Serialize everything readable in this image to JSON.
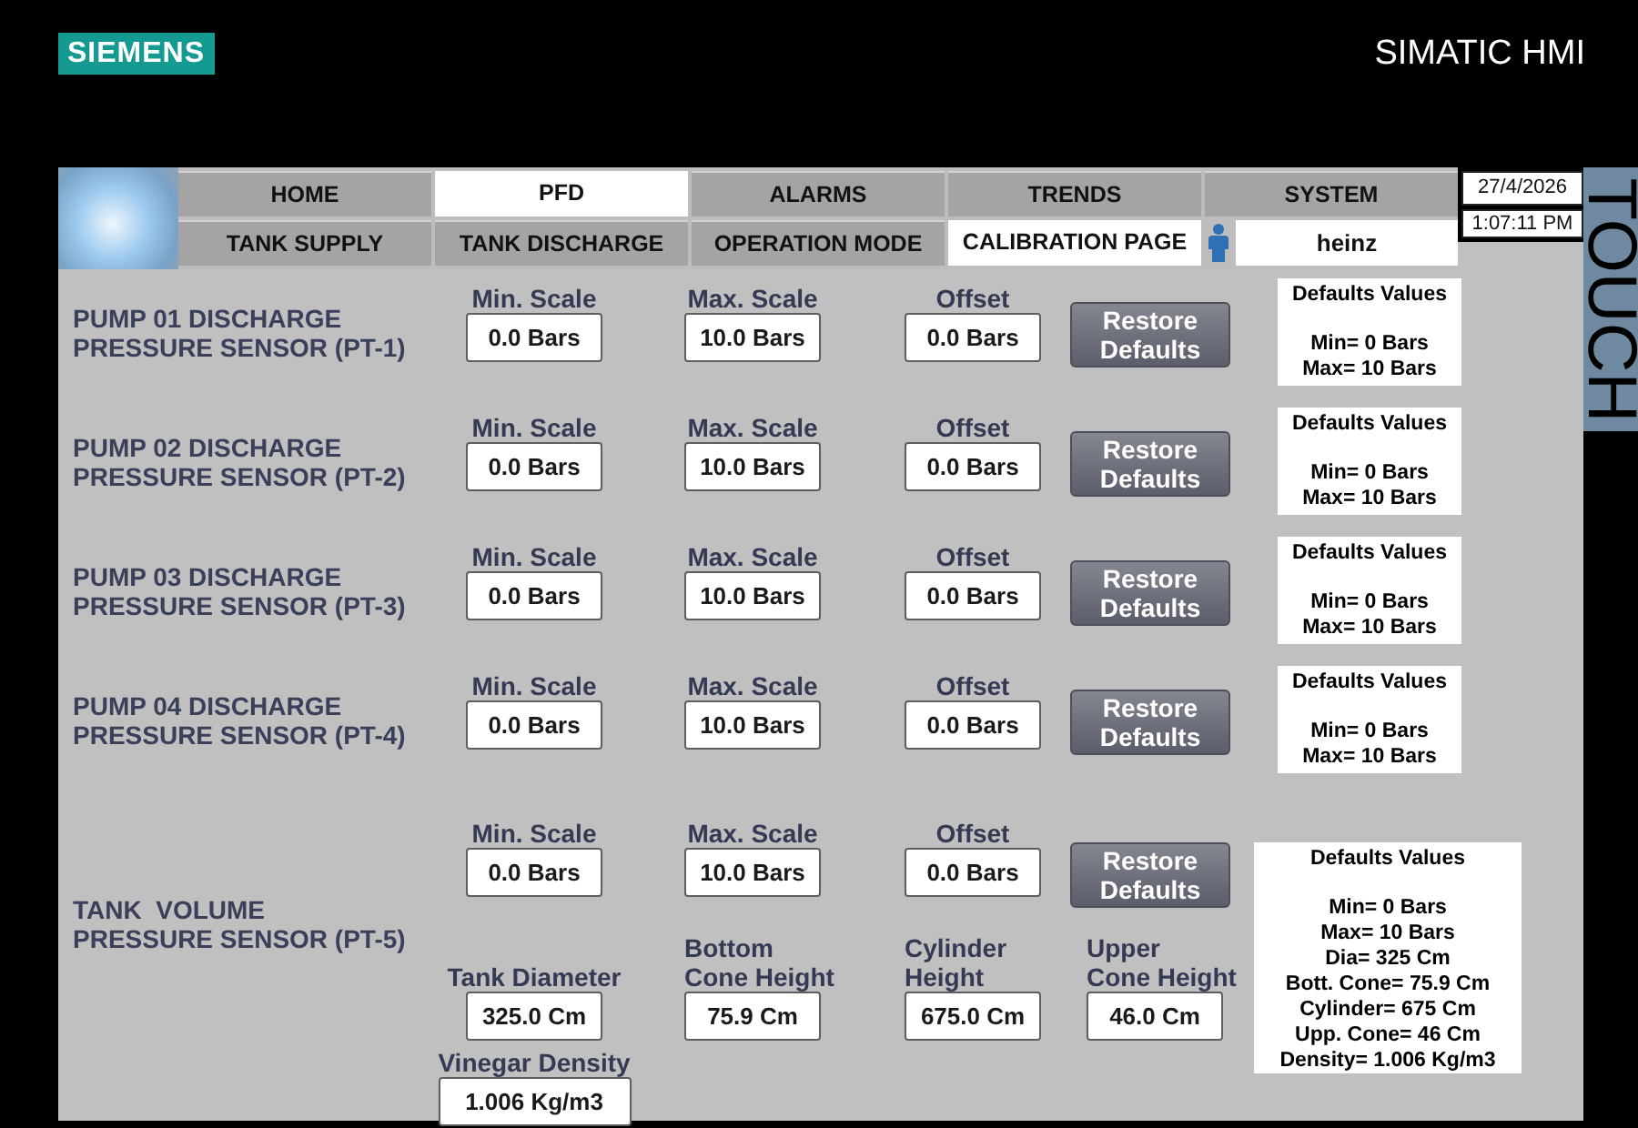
{
  "header": {
    "brand": "SIEMENS",
    "product": "SIMATIC HMI"
  },
  "nav": {
    "rows": [
      [
        {
          "label": "HOME",
          "selected": false
        },
        {
          "label": "PFD",
          "selected": true
        },
        {
          "label": "ALARMS",
          "selected": false
        },
        {
          "label": "TRENDS",
          "selected": false
        },
        {
          "label": "SYSTEM",
          "selected": false
        }
      ],
      [
        {
          "label": "TANK SUPPLY",
          "selected": false
        },
        {
          "label": "TANK DISCHARGE",
          "selected": false
        },
        {
          "label": "OPERATION MODE",
          "selected": false
        },
        {
          "label": "CALIBRATION PAGE",
          "selected": true
        }
      ]
    ]
  },
  "user": {
    "name": "heinz"
  },
  "clock": {
    "date": "27/4/2026",
    "time": "1:07:11 PM"
  },
  "side_tab": {
    "label": "TOUCH"
  },
  "sensors": [
    {
      "kind": "pump",
      "title": "PUMP 01 DISCHARGE\nPRESSURE SENSOR (PT-1)",
      "fields": [
        {
          "label": "Min. Scale",
          "value": "0.0 Bars"
        },
        {
          "label": "Max. Scale",
          "value": "10.0 Bars"
        },
        {
          "label": "Offset",
          "value": "0.0 Bars"
        }
      ],
      "button": "Restore Defaults",
      "defaults": {
        "title": "Defaults Values",
        "lines": [
          "Min= 0 Bars",
          "Max= 10 Bars"
        ]
      }
    },
    {
      "kind": "pump",
      "title": "PUMP 02 DISCHARGE\nPRESSURE SENSOR (PT-2)",
      "fields": [
        {
          "label": "Min. Scale",
          "value": "0.0 Bars"
        },
        {
          "label": "Max. Scale",
          "value": "10.0 Bars"
        },
        {
          "label": "Offset",
          "value": "0.0 Bars"
        }
      ],
      "button": "Restore Defaults",
      "defaults": {
        "title": "Defaults Values",
        "lines": [
          "Min= 0 Bars",
          "Max= 10 Bars"
        ]
      }
    },
    {
      "kind": "pump",
      "title": "PUMP 03 DISCHARGE\nPRESSURE SENSOR (PT-3)",
      "fields": [
        {
          "label": "Min. Scale",
          "value": "0.0 Bars"
        },
        {
          "label": "Max. Scale",
          "value": "10.0 Bars"
        },
        {
          "label": "Offset",
          "value": "0.0 Bars"
        }
      ],
      "button": "Restore Defaults",
      "defaults": {
        "title": "Defaults Values",
        "lines": [
          "Min= 0 Bars",
          "Max= 10 Bars"
        ]
      }
    },
    {
      "kind": "pump",
      "title": "PUMP 04 DISCHARGE\nPRESSURE SENSOR (PT-4)",
      "fields": [
        {
          "label": "Min. Scale",
          "value": "0.0 Bars"
        },
        {
          "label": "Max. Scale",
          "value": "10.0 Bars"
        },
        {
          "label": "Offset",
          "value": "0.0 Bars"
        }
      ],
      "button": "Restore Defaults",
      "defaults": {
        "title": "Defaults Values",
        "lines": [
          "Min= 0 Bars",
          "Max= 10 Bars"
        ]
      }
    },
    {
      "kind": "tank",
      "title": "TANK  VOLUME\nPRESSURE SENSOR (PT-5)",
      "fields": [
        {
          "label": "Min. Scale",
          "value": "0.0 Bars"
        },
        {
          "label": "Max. Scale",
          "value": "10.0 Bars"
        },
        {
          "label": "Offset",
          "value": "0.0 Bars"
        }
      ],
      "button": "Restore Defaults",
      "tank_fields": [
        {
          "label": "Tank Diameter",
          "value": "325.0 Cm"
        },
        {
          "label": "Bottom\nCone Height",
          "value": "75.9 Cm"
        },
        {
          "label": "Cylinder\nHeight",
          "value": "675.0 Cm"
        },
        {
          "label": "Upper\nCone Height",
          "value": "46.0 Cm"
        }
      ],
      "density_field": {
        "label": "Vinegar Density",
        "value": "1.006 Kg/m3"
      },
      "defaults": {
        "title": "Defaults Values",
        "lines": [
          "Min= 0 Bars",
          "Max= 10 Bars",
          "Dia= 325 Cm",
          "Bott. Cone= 75.9 Cm",
          "Cylinder= 675 Cm",
          "Upp. Cone= 46 Cm",
          "Density= 1.006 Kg/m3"
        ]
      }
    }
  ]
}
